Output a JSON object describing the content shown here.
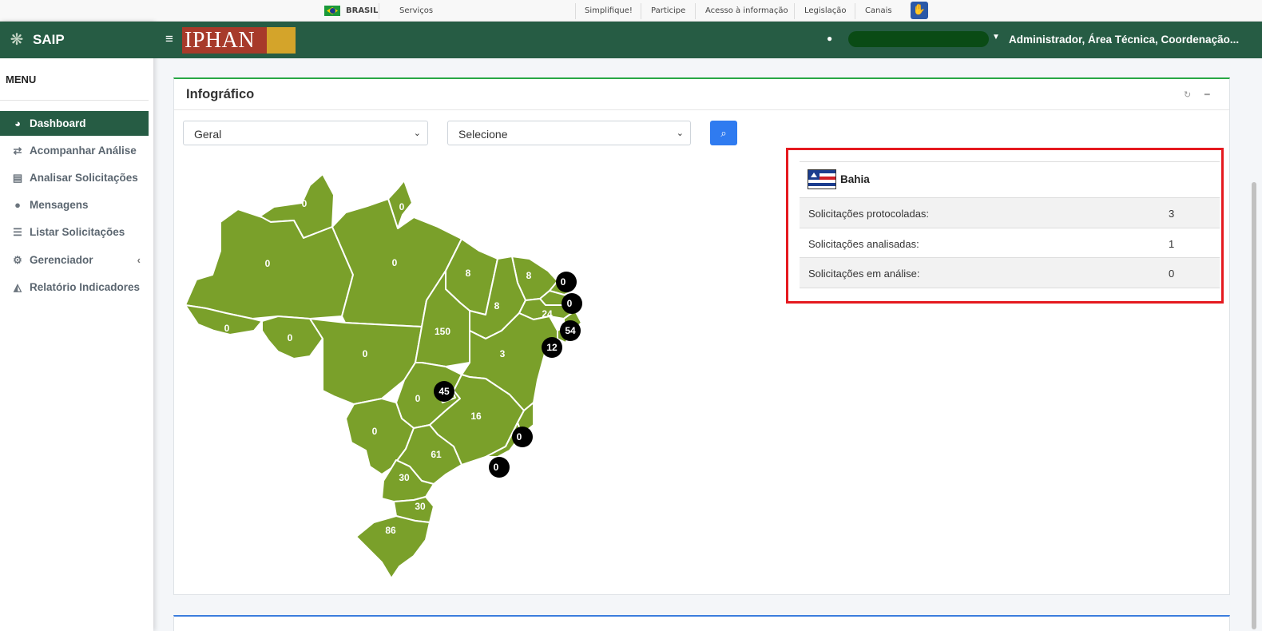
{
  "govbar": {
    "brasil": "BRASIL",
    "servicos": "Serviços",
    "links": [
      "Simplifique!",
      "Participe",
      "Acesso à informação",
      "Legislação",
      "Canais"
    ]
  },
  "brand": {
    "name": "SAIP",
    "iphan": "IPHAN"
  },
  "header": {
    "user": "Administrador, Área Técnica, Coordenação..."
  },
  "sidebar": {
    "menu_label": "MENU",
    "items": [
      {
        "label": "Dashboard",
        "icon": "dashboard-icon"
      },
      {
        "label": "Acompanhar Análise",
        "icon": "exchange-icon"
      },
      {
        "label": "Analisar Solicitações",
        "icon": "book-icon"
      },
      {
        "label": "Mensagens",
        "icon": "comments-icon"
      },
      {
        "label": "Listar Solicitações",
        "icon": "list-icon"
      },
      {
        "label": "Gerenciador",
        "icon": "cogs-icon"
      },
      {
        "label": "Relatório Indicadores",
        "icon": "area-chart-icon"
      }
    ]
  },
  "card": {
    "title": "Infográfico"
  },
  "filters": {
    "type_selected": "Geral",
    "state_selected": "Selecione"
  },
  "map": {
    "labels": {
      "rr": "0",
      "ap": "0",
      "am": "0",
      "pa": "0",
      "ma": "8",
      "ce": "8",
      "pi": "8",
      "ac": "0",
      "ro": "0",
      "mt": "0",
      "to": "150",
      "ba": "3",
      "go": "0",
      "df": "45",
      "mg": "16",
      "ms": "0",
      "sp": "61",
      "pr": "30",
      "sc": "30",
      "rs": "86",
      "pe": "24",
      "rn": "0",
      "pb": "0",
      "al": "54",
      "se": "12",
      "es": "0",
      "rj": "0"
    }
  },
  "info": {
    "state": "Bahia",
    "rows": [
      {
        "label": "Solicitações protocoladas:",
        "value": "3"
      },
      {
        "label": "Solicitações analisadas:",
        "value": "1"
      },
      {
        "label": "Solicitações em análise:",
        "value": "0"
      }
    ]
  },
  "colors": {
    "brand_green": "#265c44",
    "map_green": "#7aa02a",
    "highlight_red": "#e5191f",
    "button_blue": "#2f7bf0"
  }
}
